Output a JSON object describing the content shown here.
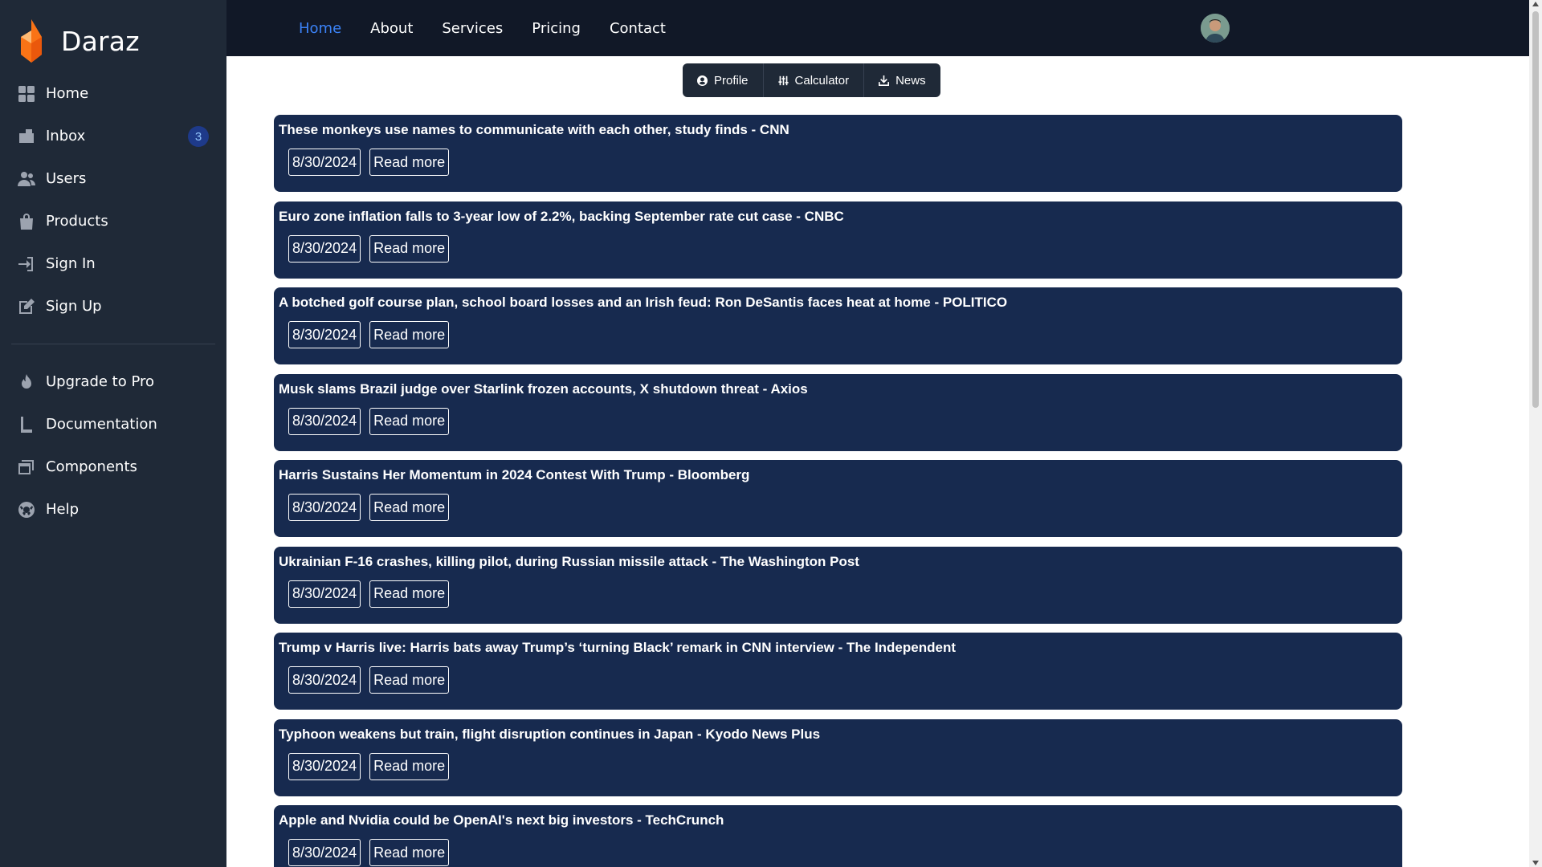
{
  "brand": {
    "name": "Daraz",
    "logo_colors": [
      "#f97316",
      "#ea580c"
    ]
  },
  "sidebar": {
    "items": [
      {
        "label": "Home",
        "icon": "grid-icon"
      },
      {
        "label": "Inbox",
        "icon": "inbox-icon",
        "badge": "3"
      },
      {
        "label": "Users",
        "icon": "users-icon"
      },
      {
        "label": "Products",
        "icon": "bag-icon"
      },
      {
        "label": "Sign In",
        "icon": "sign-in-icon"
      },
      {
        "label": "Sign Up",
        "icon": "edit-icon"
      }
    ],
    "secondary": [
      {
        "label": "Upgrade to Pro",
        "icon": "fire-icon"
      },
      {
        "label": "Documentation",
        "icon": "book-icon"
      },
      {
        "label": "Components",
        "icon": "window-icon"
      },
      {
        "label": "Help",
        "icon": "lifebuoy-icon"
      }
    ]
  },
  "topnav": {
    "links": [
      "Home",
      "About",
      "Services",
      "Pricing",
      "Contact"
    ],
    "active": "Home",
    "accent": "#3b82f6"
  },
  "tabs": [
    {
      "label": "Profile",
      "icon": "user-circle-icon"
    },
    {
      "label": "Calculator",
      "icon": "sliders-icon"
    },
    {
      "label": "News",
      "icon": "download-icon"
    }
  ],
  "news": [
    {
      "title": "These monkeys use names to communicate with each other, study finds - CNN",
      "date": "8/30/2024",
      "link": "Read more"
    },
    {
      "title": "Euro zone inflation falls to 3-year low of 2.2%, backing September rate cut case - CNBC",
      "date": "8/30/2024",
      "link": "Read more"
    },
    {
      "title": "A botched golf course plan, school board losses and an Irish feud: Ron DeSantis faces heat at home - POLITICO",
      "date": "8/30/2024",
      "link": "Read more"
    },
    {
      "title": "Musk slams Brazil judge over Starlink frozen accounts, X shutdown threat - Axios",
      "date": "8/30/2024",
      "link": "Read more"
    },
    {
      "title": "Harris Sustains Her Momentum in 2024 Contest With Trump - Bloomberg",
      "date": "8/30/2024",
      "link": "Read more"
    },
    {
      "title": "Ukrainian F-16 crashes, killing pilot, during Russian missile attack - The Washington Post",
      "date": "8/30/2024",
      "link": "Read more"
    },
    {
      "title": "Trump v Harris live: Harris bats away Trump’s ‘turning Black’ remark in CNN interview - The Independent",
      "date": "8/30/2024",
      "link": "Read more"
    },
    {
      "title": "Typhoon weakens but train, flight disruption continues in Japan - Kyodo News Plus",
      "date": "8/30/2024",
      "link": "Read more"
    },
    {
      "title": "Apple and Nvidia could be OpenAI's next big investors - TechCrunch",
      "date": "8/30/2024",
      "link": "Read more"
    }
  ]
}
